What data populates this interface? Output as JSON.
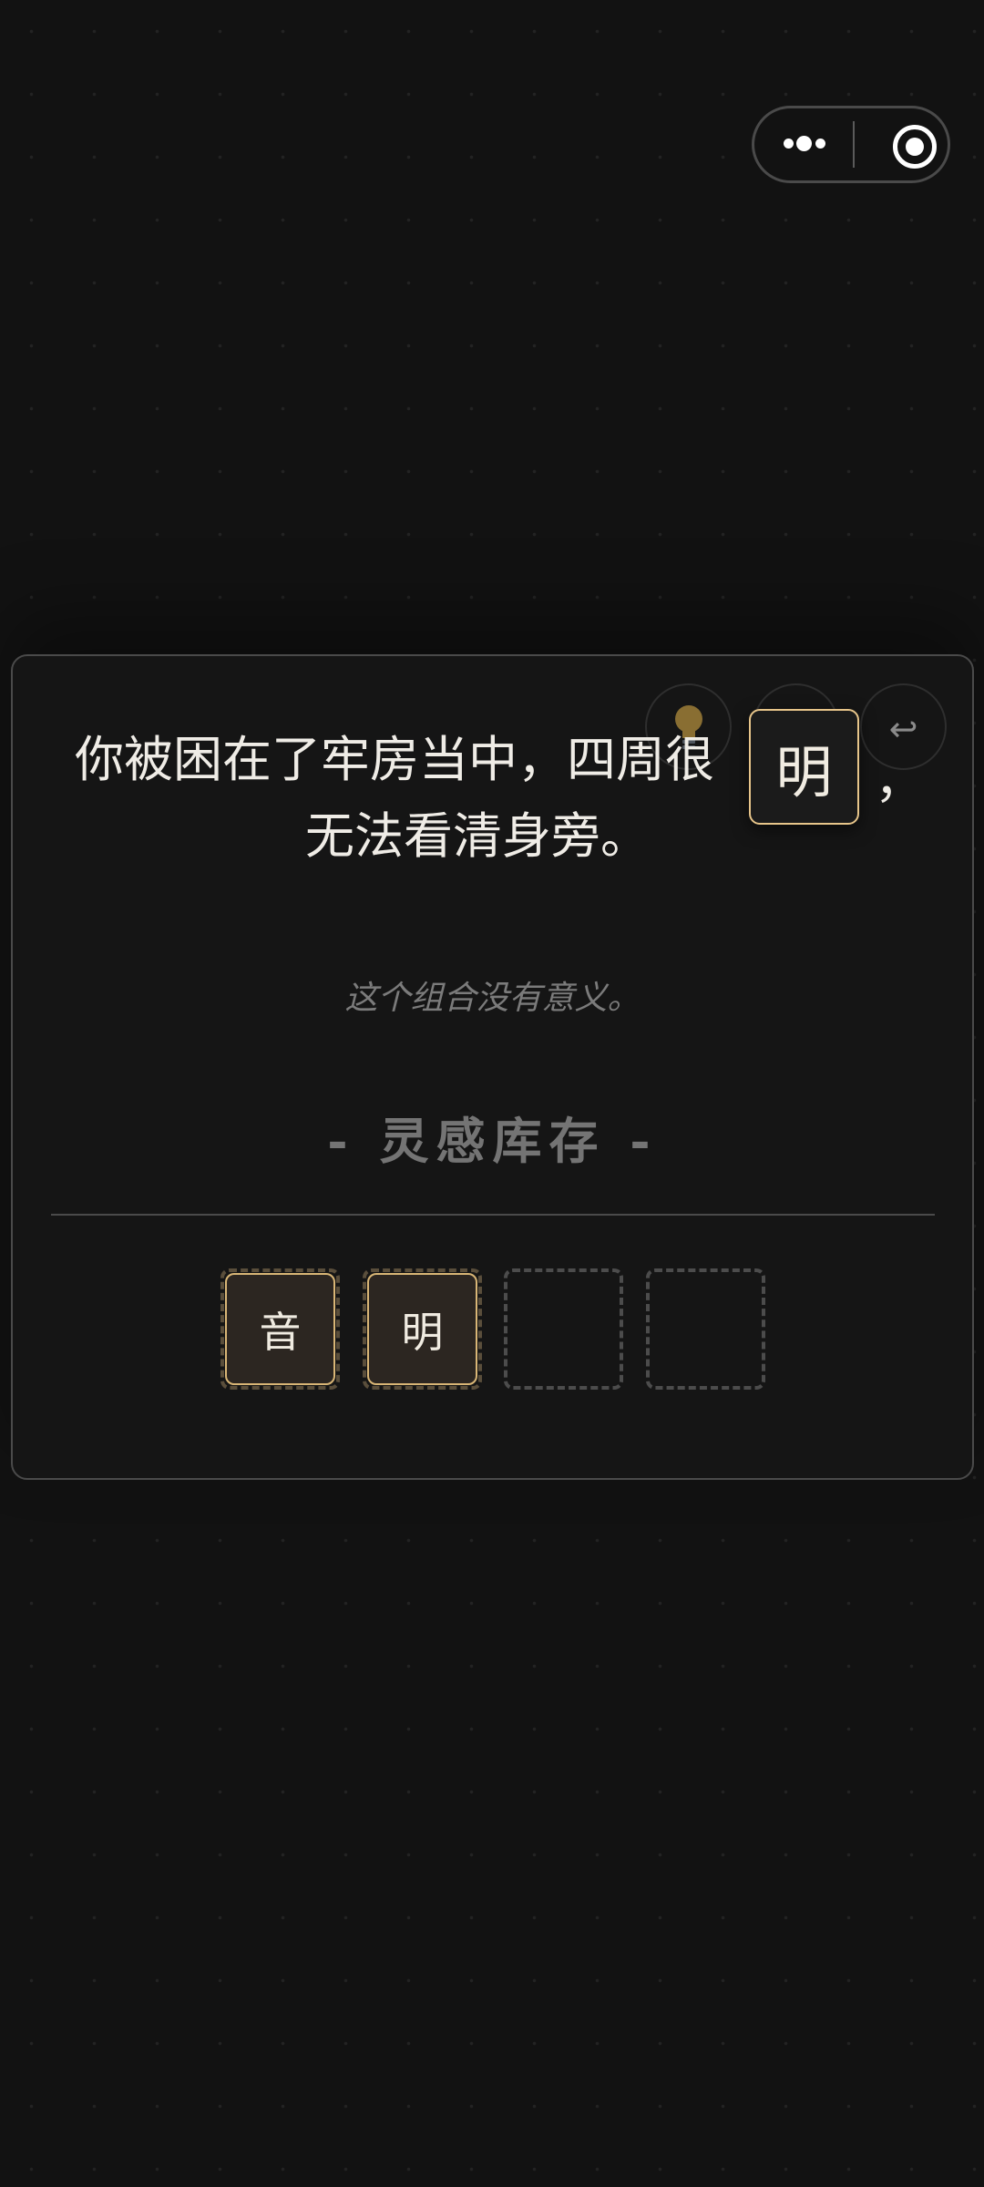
{
  "capsule": {
    "more_icon": "more-dots-icon",
    "close_icon": "target-circle-icon"
  },
  "toolbar": {
    "hint_icon": "lightbulb-icon",
    "settings_icon": "gear-icon",
    "undo_icon": "undo-arrow-icon",
    "settings_glyph": "⚙",
    "undo_glyph": "↩"
  },
  "story": {
    "line1": "你被困在了牢房当中，四周很",
    "line2": "无法看清身旁。",
    "comma": "，",
    "floating_char": "明"
  },
  "feedback": "这个组合没有意义。",
  "inventory": {
    "title": "- 灵感库存 -",
    "slots": [
      {
        "char": "音",
        "filled": true
      },
      {
        "char": "明",
        "filled": true
      },
      {
        "char": "",
        "filled": false
      },
      {
        "char": "",
        "filled": false
      }
    ]
  },
  "colors": {
    "background": "#121212",
    "accent_gold": "#d9b676",
    "tile_fill": "#2c2621"
  }
}
